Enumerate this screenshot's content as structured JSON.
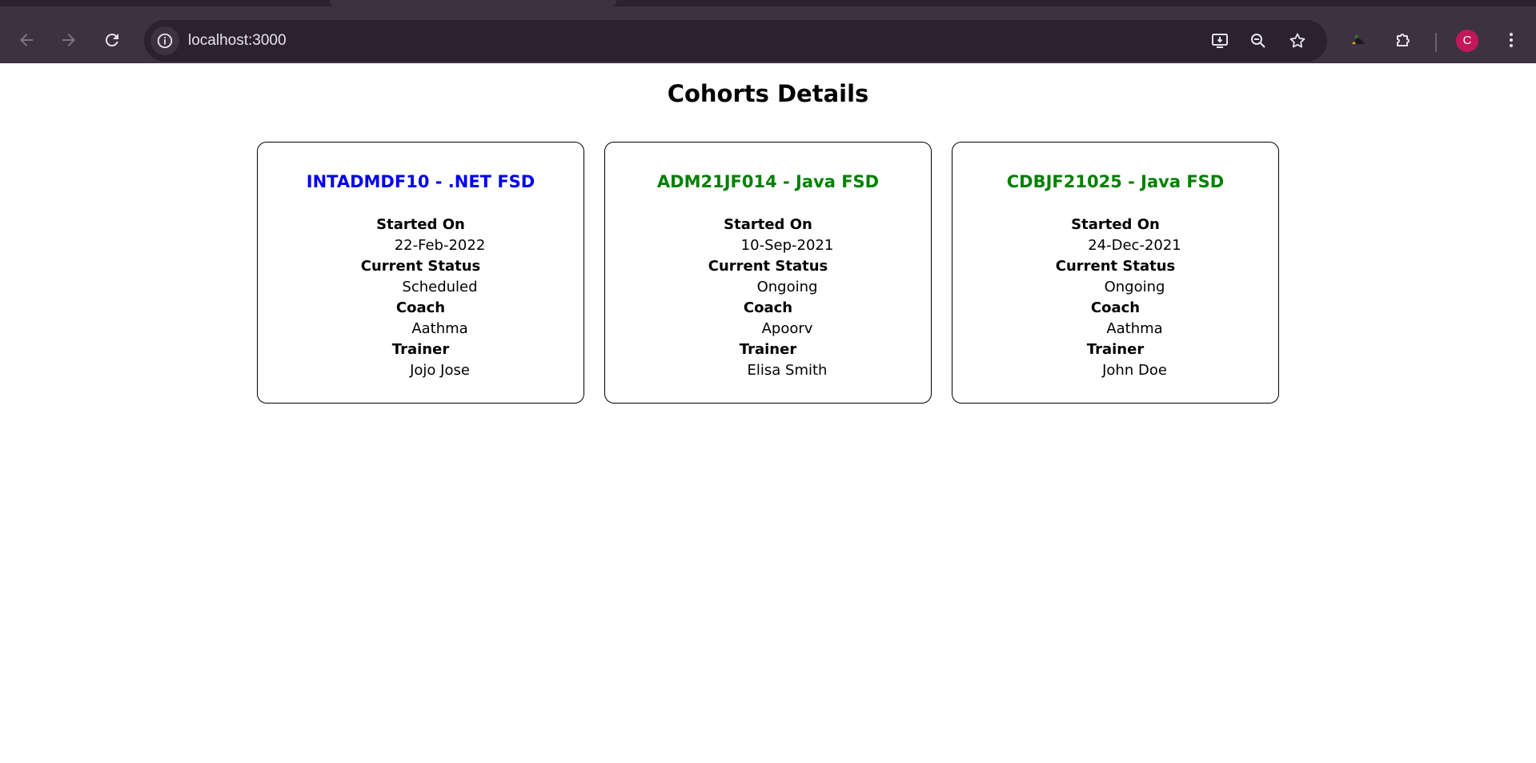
{
  "browser": {
    "url": "localhost:3000",
    "avatar_letter": "C"
  },
  "page": {
    "title": "Cohorts Details"
  },
  "cohorts": [
    {
      "code": "INTADMDF10",
      "separator": " - ",
      "technology": ".NET FSD",
      "title_color": "blue",
      "started_on_label": "Started On",
      "started_on": "22-Feb-2022",
      "status_label": "Current Status",
      "status": "Scheduled",
      "coach_label": "Coach",
      "coach": "Aathma",
      "trainer_label": "Trainer",
      "trainer": "Jojo Jose"
    },
    {
      "code": "ADM21JF014",
      "separator": " - ",
      "technology": "Java FSD",
      "title_color": "green",
      "started_on_label": "Started On",
      "started_on": "10-Sep-2021",
      "status_label": "Current Status",
      "status": "Ongoing",
      "coach_label": "Coach",
      "coach": "Apoorv",
      "trainer_label": "Trainer",
      "trainer": "Elisa Smith"
    },
    {
      "code": "CDBJF21025",
      "separator": " - ",
      "technology": "Java FSD",
      "title_color": "green",
      "started_on_label": "Started On",
      "started_on": "24-Dec-2021",
      "status_label": "Current Status",
      "status": "Ongoing",
      "coach_label": "Coach",
      "coach": "Aathma",
      "trainer_label": "Trainer",
      "trainer": "John Doe"
    }
  ]
}
